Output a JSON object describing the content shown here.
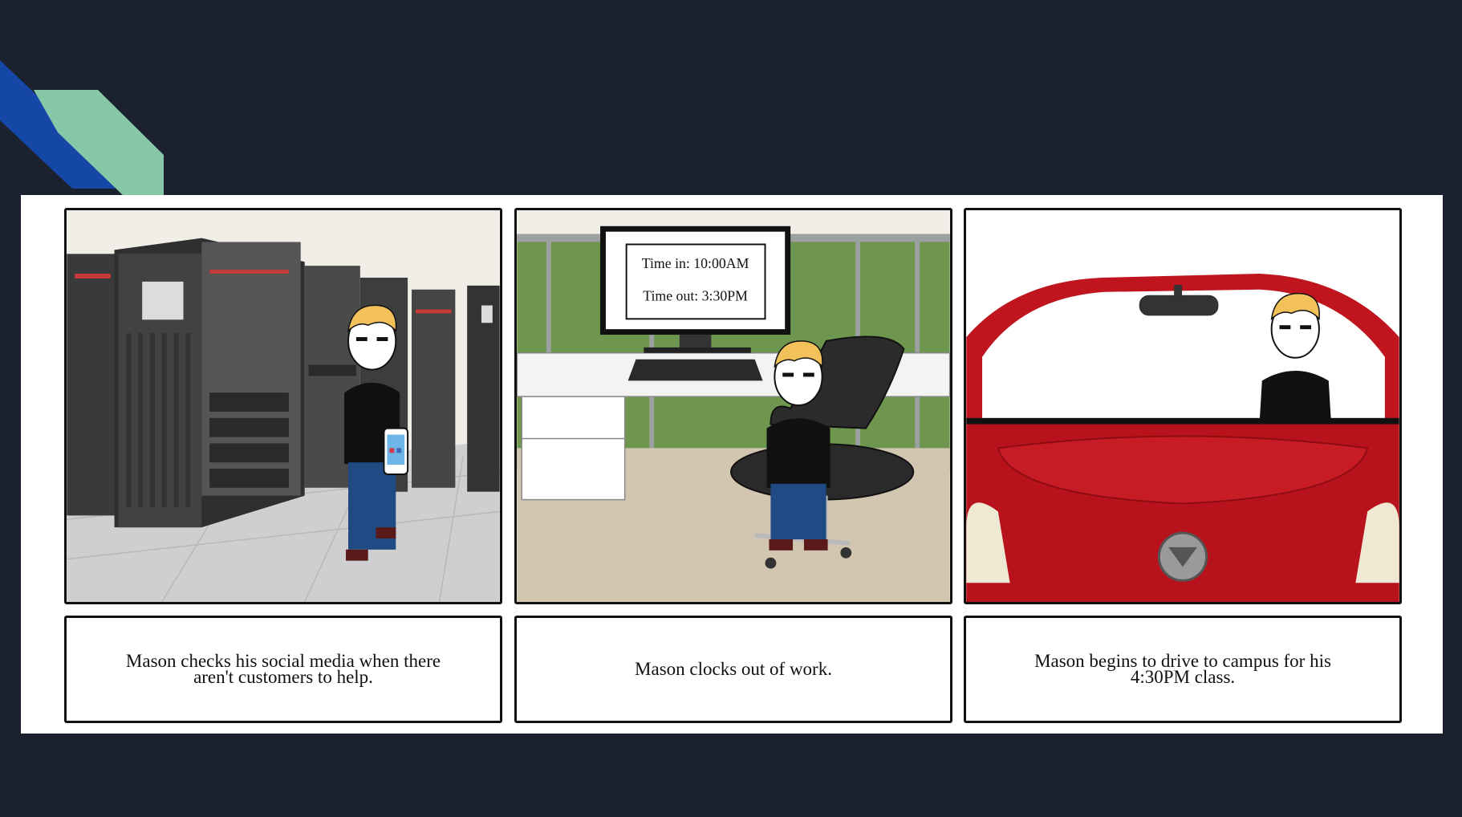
{
  "storyboard": {
    "panels": [
      {
        "scene": "server room",
        "caption": "Mason checks his social media when there aren't customers to help."
      },
      {
        "scene": "office cubicle",
        "monitor": {
          "time_in": "Time in: 10:00AM",
          "time_out": "Time out: 3:30PM"
        },
        "caption": "Mason clocks out of work."
      },
      {
        "scene": "red car",
        "caption": "Mason begins to drive to campus for his 4:30PM class."
      }
    ]
  },
  "colors": {
    "background": "#1b212e",
    "accent_blue": "#1447a6",
    "accent_green": "#86c7a8",
    "car_red": "#c0151f",
    "cubicle_green": "#6f964f"
  }
}
